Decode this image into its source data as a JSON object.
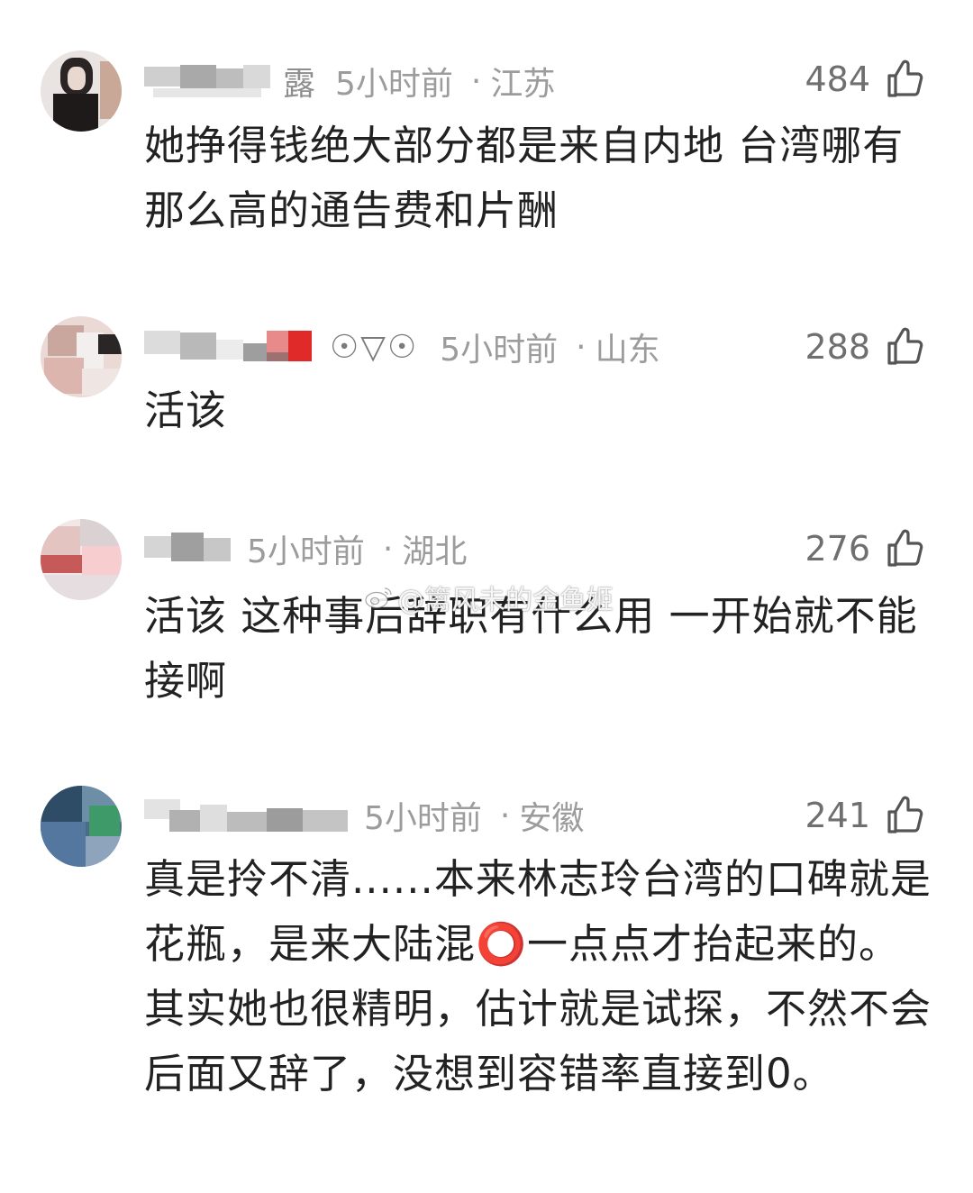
{
  "comments": [
    {
      "name_visible": "露",
      "time": "5小时前",
      "location": "江苏",
      "likes": "484",
      "text": "她挣得钱绝大部分都是来自内地 台湾哪有那么高的通告费和片酬"
    },
    {
      "name_visible": "",
      "name_glyphs": "☉▽☉",
      "time": "5小时前",
      "location": "山东",
      "likes": "288",
      "text": "活该"
    },
    {
      "name_visible": "",
      "time": "5小时前",
      "location": "湖北",
      "likes": "276",
      "text": "活该 这种事后辞职有什么用 一开始就不能接啊"
    },
    {
      "name_visible": "",
      "time": "5小时前",
      "location": "安徽",
      "likes": "241",
      "text": "真是拎不清......本来林志玲台湾的口碑就是花瓶，是来大陆混⭕️一点点才抬起来的。其实她也很精明，估计就是试探，不然不会后面又辞了，没想到容错率直接到0。"
    }
  ],
  "separator": "·",
  "watermark": "@篱风未的金鱼姬",
  "icons": {
    "like": "thumbs-up-icon",
    "weibo": "weibo-logo-icon"
  },
  "colors": {
    "meta": "#9c9c9c",
    "text": "#222222",
    "likes": "#6f6f6f"
  }
}
